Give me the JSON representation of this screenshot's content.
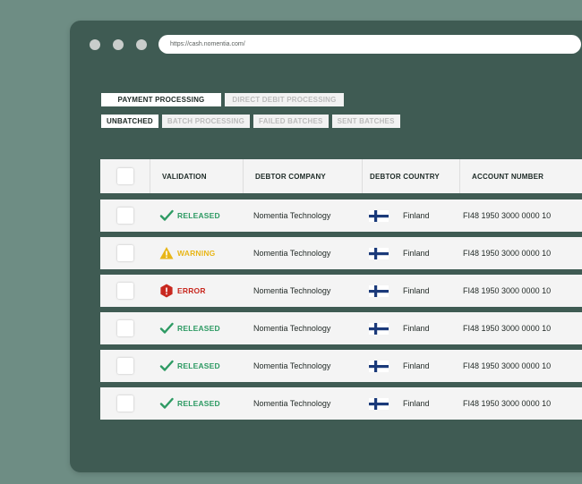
{
  "browser": {
    "url": "https://cash.nomentia.com/"
  },
  "tabs_primary": [
    {
      "label": "PAYMENT PROCESSING",
      "active": true
    },
    {
      "label": "DIRECT DEBIT PROCESSING",
      "active": false
    }
  ],
  "tabs_secondary": [
    {
      "label": "UNBATCHED",
      "active": true
    },
    {
      "label": "BATCH PROCESSING",
      "active": false
    },
    {
      "label": "FAILED BATCHES",
      "active": false
    },
    {
      "label": "SENT BATCHES",
      "active": false
    }
  ],
  "table": {
    "columns": [
      "VALIDATION",
      "DEBTOR COMPANY",
      "DEBTOR COUNTRY",
      "ACCOUNT NUMBER"
    ],
    "rows": [
      {
        "validation": "RELEASED",
        "status": "released",
        "company": "Nomentia Technology",
        "country": "Finland",
        "account": "FI48 1950 3000 0000 10"
      },
      {
        "validation": "WARNING",
        "status": "warning",
        "company": "Nomentia Technology",
        "country": "Finland",
        "account": "FI48 1950 3000 0000 10"
      },
      {
        "validation": "ERROR",
        "status": "error",
        "company": "Nomentia Technology",
        "country": "Finland",
        "account": "FI48 1950 3000 0000 10"
      },
      {
        "validation": "RELEASED",
        "status": "released",
        "company": "Nomentia Technology",
        "country": "Finland",
        "account": "FI48 1950 3000 0000 10"
      },
      {
        "validation": "RELEASED",
        "status": "released",
        "company": "Nomentia Technology",
        "country": "Finland",
        "account": "FI48 1950 3000 0000 10"
      },
      {
        "validation": "RELEASED",
        "status": "released",
        "company": "Nomentia Technology",
        "country": "Finland",
        "account": "FI48 1950 3000 0000 10"
      }
    ]
  },
  "colors": {
    "background": "#6e8d84",
    "window": "#3f5b53",
    "released": "#2d9a63",
    "warning": "#e8b618",
    "error": "#c8281f",
    "flag_blue": "#1b3a7a"
  },
  "icons": {
    "released": "checkmark-icon",
    "warning": "warning-triangle-icon",
    "error": "error-hexagon-icon",
    "country": "finland-flag-icon"
  }
}
